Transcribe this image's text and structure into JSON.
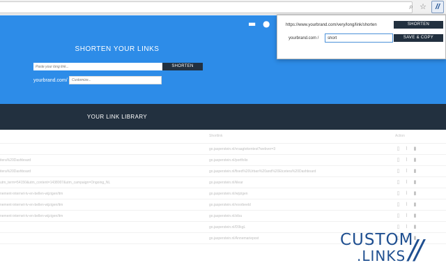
{
  "browser": {
    "zoom_icon": "search-icon",
    "star_icon": "star-icon",
    "extension_label": "//"
  },
  "hero": {
    "title": "SHORTEN YOUR LINKS",
    "url_placeholder": "Paste your long link...",
    "shorten_label": "SHORTEN",
    "domain_label": "yourbrand.com/",
    "custom_placeholder": "Customize..."
  },
  "library": {
    "title": "YOUR LINK LIBRARY",
    "headers": [
      "Shortlink",
      "Action"
    ],
    "rows": [
      {
        "long": "",
        "short": "go.jasperstein.nl/vraagtekentest?webver=3"
      },
      {
        "long": "itera%20Dashboard",
        "short": "go.jasperstein.nl/portfolio"
      },
      {
        "long": "itera%20Dashboard",
        "short": "go.jasperstein.nl/fixed%20Urban%20and%20Etcetera%20Dashboard"
      },
      {
        "long": "utm_term=54150&utm_content=1438007&utm_campaign=Ongoing_NL",
        "short": "go.jasperstein.nl/klear"
      },
      {
        "long": "nement-internet-tv-en-bellen-wijzigen/itm",
        "short": "go.jasperstein.nl/wijzigen"
      },
      {
        "long": "nement-internet-tv-en-bellen-wijzigen/itm",
        "short": "go.jasperstein.nl/voorbeeld"
      },
      {
        "long": "nement-internet-tv-en-bellen-wijzigen/itm",
        "short": "go.jasperstein.nl/ziba"
      },
      {
        "long": "",
        "short": "go.jasperstein.nl/D9kgL"
      },
      {
        "long": "",
        "short": "go.jasperstein.nl/Annemariepost"
      }
    ],
    "action_icons": [
      "file-icon",
      "chart-icon",
      "trash-icon"
    ]
  },
  "popup": {
    "long_url": "https://www.yourbrand.com/very/long/link/shorten",
    "shorten_label": "SHORTEN",
    "domain_label": "yourbrand.com /",
    "short_value": "short",
    "save_label": "SAVE & COPY"
  },
  "logo": {
    "line1": "CUSTOM",
    "line2": ".LINKS",
    "slashes": "//"
  },
  "colors": {
    "hero_blue": "#2d8ce8",
    "dark_navy": "#22303f",
    "logo_blue": "#1f4f90"
  }
}
